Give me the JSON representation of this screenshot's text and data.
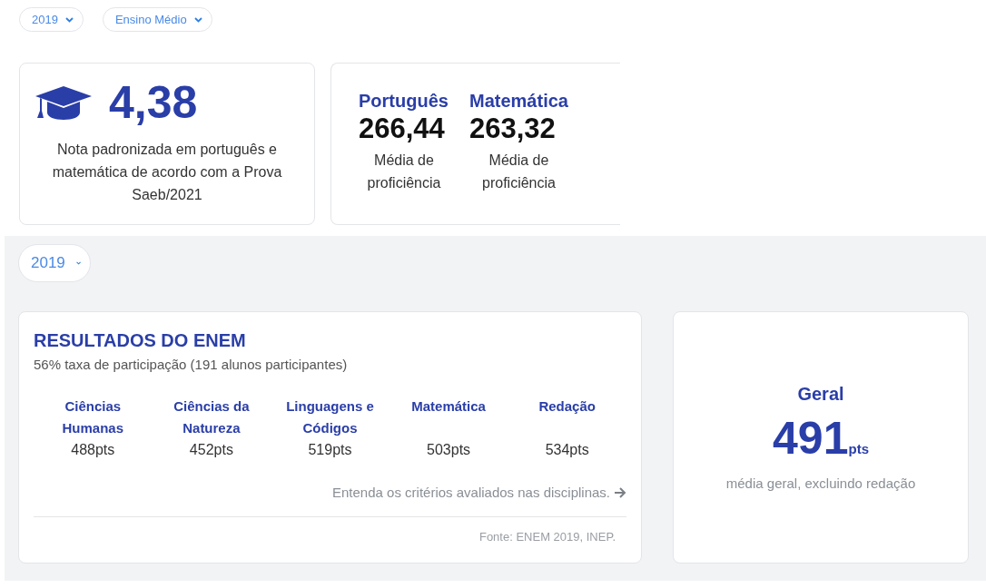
{
  "filters": [
    {
      "value": "2019"
    },
    {
      "value": "Ensino Médio"
    }
  ],
  "score_card": {
    "value": "4,38",
    "description": "Nota padronizada em português e matemática de acordo com a Prova Saeb/2021"
  },
  "proficiency": [
    {
      "subject": "Português",
      "value": "266,44",
      "caption": "Média de proficiência"
    },
    {
      "subject": "Matemática",
      "value": "263,32",
      "caption": "Média de proficiência"
    }
  ],
  "enem_filter": {
    "value": "2019"
  },
  "enem": {
    "title": "RESULTADOS DO ENEM",
    "subtitle": "56% taxa de participação (191 alunos participantes)",
    "areas": [
      {
        "name": "Ciências Humanas",
        "score": "488pts"
      },
      {
        "name": "Ciências da Natureza",
        "score": "452pts"
      },
      {
        "name": "Linguagens e Códigos",
        "score": "519pts"
      },
      {
        "name": "Matemática",
        "score": "503pts"
      },
      {
        "name": "Redação",
        "score": "534pts"
      }
    ],
    "link": "Entenda os critérios avaliados nas disciplinas.",
    "source": "Fonte: ENEM 2019, INEP."
  },
  "overall": {
    "title": "Geral",
    "value": "491",
    "unit": "pts",
    "caption": "média geral, excluindo redação"
  }
}
